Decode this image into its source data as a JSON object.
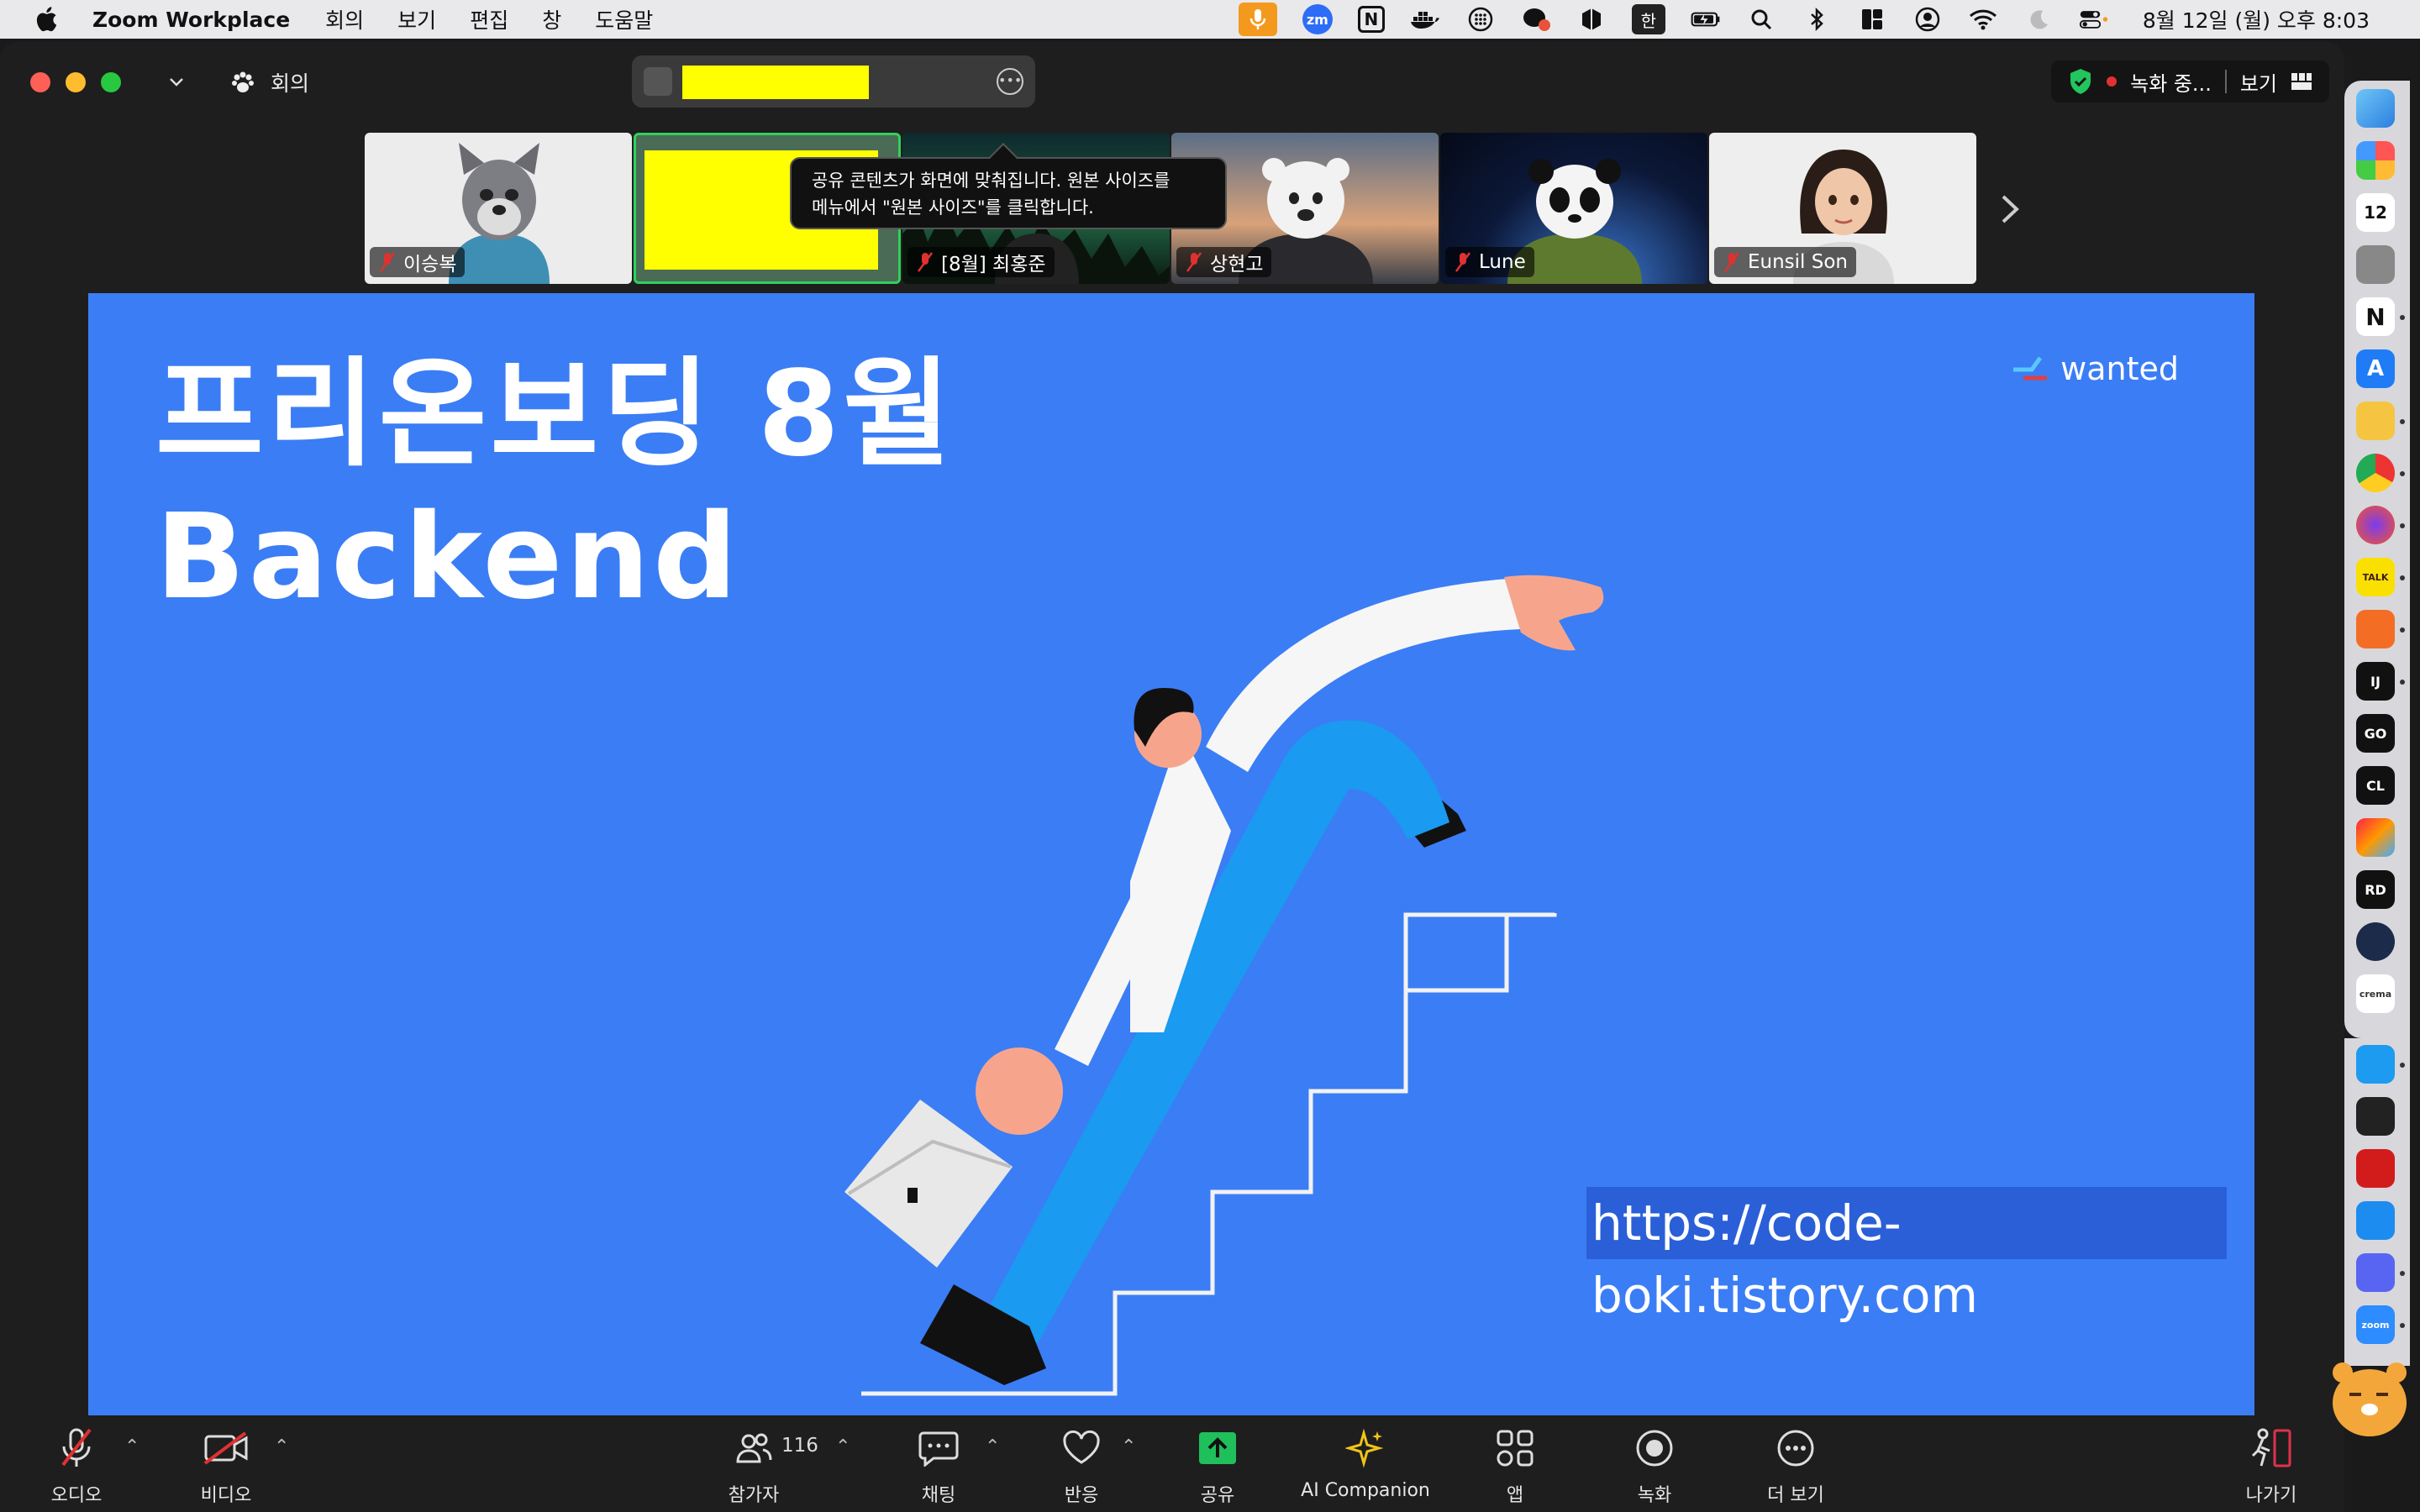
{
  "menubar": {
    "app_name": "Zoom Workplace",
    "menus": [
      "회의",
      "보기",
      "편집",
      "창",
      "도움말"
    ],
    "tray": {
      "zoom_badge": "zm",
      "notion_badge": "N",
      "input_method": "한",
      "clock": "8월 12일 (월) 오후 8:03"
    }
  },
  "titlebar": {
    "meeting_menu_label": "회의",
    "recording_label": "녹화 중...",
    "view_label": "보기"
  },
  "tooltip": {
    "line1": "공유 콘텐츠가 화면에 맞춰집니다. 원본 사이즈를",
    "line2": "메뉴에서 \"원본 사이즈\"를 클릭합니다."
  },
  "participants": [
    {
      "name": "이승복"
    },
    {
      "name": ""
    },
    {
      "name": "[8월] 최홍준"
    },
    {
      "name": "상현고"
    },
    {
      "name": "Lune"
    },
    {
      "name": "Eunsil Son"
    }
  ],
  "slide": {
    "title_line1": "프리온보딩 8월",
    "title_line2": "Backend",
    "brand": "wanted",
    "url": "https://code-boki.tistory.com"
  },
  "toolbar": {
    "audio": "오디오",
    "video": "비디오",
    "participants": "참가자",
    "participant_count": "116",
    "chat": "채팅",
    "reactions": "반응",
    "share": "공유",
    "ai_companion": "AI Companion",
    "apps": "앱",
    "record": "녹화",
    "more": "더 보기",
    "leave": "나가기"
  },
  "dock": {
    "calendar_day": "12"
  },
  "colors": {
    "slide_bg": "#3b7df5",
    "share_green": "#1fbf5c",
    "muted_red": "#e03131",
    "leave_red": "#e0314a",
    "active_speaker": "#2fd15b"
  }
}
